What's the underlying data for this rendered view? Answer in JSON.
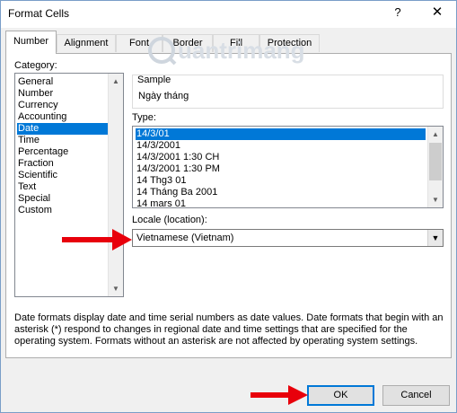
{
  "window": {
    "title": "Format Cells",
    "help_label": "?",
    "close_label": "✕"
  },
  "tabs": [
    {
      "label": "Number"
    },
    {
      "label": "Alignment"
    },
    {
      "label": "Font"
    },
    {
      "label": "Border"
    },
    {
      "label": "Fill"
    },
    {
      "label": "Protection"
    }
  ],
  "category": {
    "label": "Category:",
    "items": [
      "General",
      "Number",
      "Currency",
      "Accounting",
      "Date",
      "Time",
      "Percentage",
      "Fraction",
      "Scientific",
      "Text",
      "Special",
      "Custom"
    ],
    "selected": "Date"
  },
  "sample": {
    "label": "Sample",
    "value": "Ngày tháng"
  },
  "type": {
    "label": "Type:",
    "items": [
      "14/3/01",
      "14/3/2001",
      "14/3/2001 1:30 CH",
      "14/3/2001 1:30 PM",
      "14 Thg3 01",
      "14 Tháng Ba 2001",
      "14 mars 01"
    ],
    "selected": "14/3/01"
  },
  "locale": {
    "label": "Locale (location):",
    "value": "Vietnamese (Vietnam)"
  },
  "description": "Date formats display date and time serial numbers as date values.  Date formats that begin with an asterisk (*) respond to changes in regional date and time settings that are specified for the operating system. Formats without an asterisk are not affected by operating system settings.",
  "buttons": {
    "ok": "OK",
    "cancel": "Cancel"
  },
  "watermark": {
    "text": "uantrimang"
  },
  "colors": {
    "selection": "#0078d7",
    "arrow": "#e8000b"
  },
  "icons": [
    "help-icon",
    "close-icon",
    "scroll-up-icon",
    "scroll-down-icon",
    "dropdown-arrow-icon",
    "red-arrow-icon"
  ]
}
